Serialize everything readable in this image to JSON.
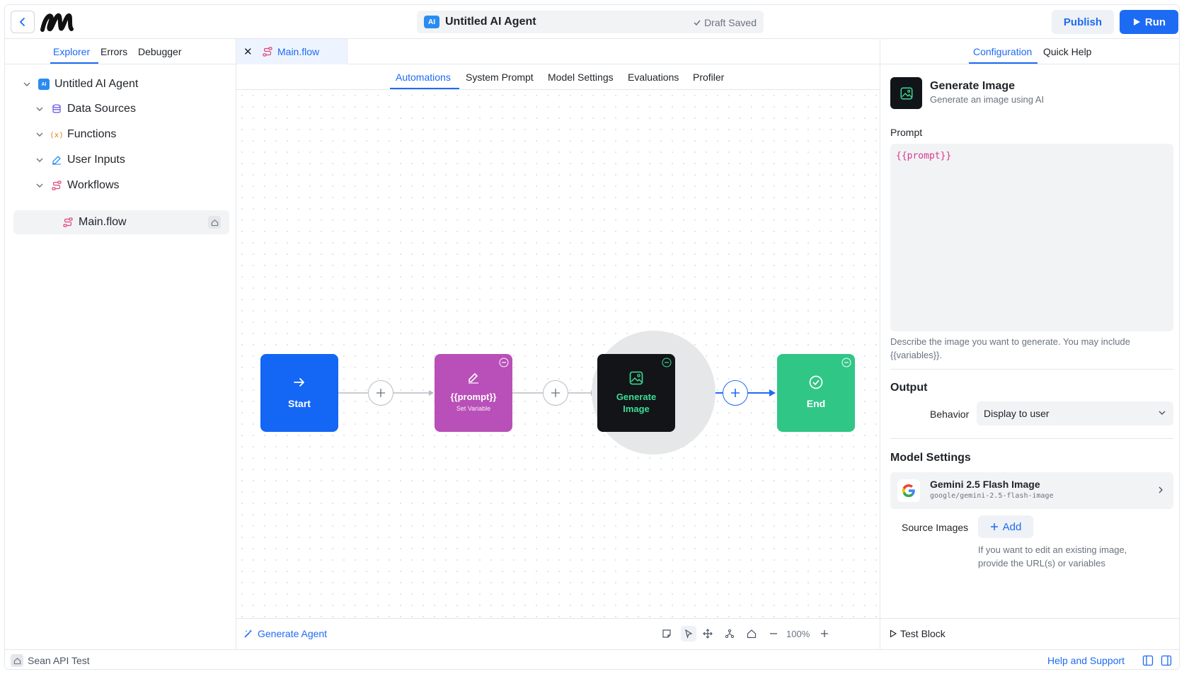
{
  "header": {
    "agent_badge": "AI",
    "agent_title": "Untitled AI Agent",
    "draft_status": "Draft Saved",
    "publish_label": "Publish",
    "run_label": "Run"
  },
  "left_panel": {
    "tabs": [
      "Explorer",
      "Errors",
      "Debugger"
    ],
    "tree": {
      "root": "Untitled AI Agent",
      "root_badge": "AI",
      "items": [
        "Data Sources",
        "Functions",
        "User Inputs",
        "Workflows"
      ],
      "function_glyph": "(x)",
      "selected_file": "Main.flow"
    }
  },
  "center": {
    "open_file": "Main.flow",
    "sub_tabs": [
      "Automations",
      "System Prompt",
      "Model Settings",
      "Evaluations",
      "Profiler"
    ],
    "nodes": {
      "start": "Start",
      "set_variable_title": "{{prompt}}",
      "set_variable_sub": "Set Variable",
      "generate_line1": "Generate",
      "generate_line2": "Image",
      "end": "End"
    },
    "bottom": {
      "generate_agent": "Generate Agent",
      "zoom": "100%"
    }
  },
  "right_panel": {
    "tabs": [
      "Configuration",
      "Quick Help"
    ],
    "block_title": "Generate Image",
    "block_desc": "Generate an image using AI",
    "prompt_label": "Prompt",
    "prompt_value": "{{prompt}}",
    "prompt_help_1": "Describe the image you want to generate. You may include",
    "prompt_help_2": "{{variables}}.",
    "output_title": "Output",
    "behavior_label": "Behavior",
    "behavior_value": "Display to user",
    "model_settings_title": "Model Settings",
    "model_name": "Gemini 2.5 Flash Image",
    "model_id": "google/gemini-2.5-flash-image",
    "source_images_label": "Source Images",
    "add_label": "Add",
    "source_help_1": "If you want to edit an existing image,",
    "source_help_2": "provide the URL(s) or variables",
    "test_block": "Test Block"
  },
  "status_bar": {
    "workspace": "Sean API Test",
    "help_support": "Help and Support"
  },
  "colors": {
    "accent": "#1d6bf3",
    "start_node": "#1466f5",
    "set_variable_node": "#b94fb8",
    "generate_node": "#121417",
    "generate_text": "#3ddc97",
    "end_node": "#2fc686"
  }
}
